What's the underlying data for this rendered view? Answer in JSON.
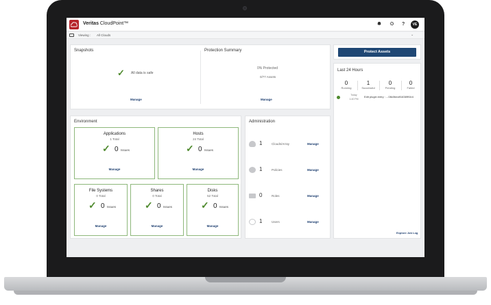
{
  "app": {
    "brand_bold": "Veritas",
    "brand_name": "CloudPoint",
    "brand_tm": "™",
    "user_initials": "VE"
  },
  "topbar_icons": {
    "alerts": "bell-icon",
    "settings": "gear-icon",
    "help": "?"
  },
  "subbar": {
    "viewing_label": "Viewing :",
    "viewing_value": "All Clouds"
  },
  "snapshots": {
    "title": "Snapshots",
    "message": "All data is safe",
    "manage": "Manage"
  },
  "protection": {
    "title": "Protection Summary",
    "percent": "0% Protected",
    "assets": "0/77 Assets",
    "manage": "Manage"
  },
  "environment": {
    "title": "Environment",
    "tiles": [
      {
        "title": "Applications",
        "total": "1 Total",
        "count": "0",
        "issues": "Issues",
        "manage": "Manage"
      },
      {
        "title": "Hosts",
        "total": "24 Total",
        "count": "0",
        "issues": "Issues",
        "manage": "Manage"
      },
      {
        "title": "File Systems",
        "total": "0 Total",
        "count": "0",
        "issues": "Issues",
        "manage": "Manage"
      },
      {
        "title": "Shares",
        "total": "0 Total",
        "count": "0",
        "issues": "Issues",
        "manage": "Manage"
      },
      {
        "title": "Disks",
        "total": "52 Total",
        "count": "0",
        "issues": "Issues",
        "manage": "Manage"
      }
    ]
  },
  "administration": {
    "title": "Administration",
    "rows": [
      {
        "icon": "cloud-icon",
        "count": "1",
        "label": "Clouds/Array",
        "manage": "Manage"
      },
      {
        "icon": "policy-icon",
        "count": "1",
        "label": "Policies",
        "manage": "Manage"
      },
      {
        "icon": "roles-icon",
        "count": "0",
        "label": "Roles",
        "manage": "Manage"
      },
      {
        "icon": "user-icon",
        "count": "1",
        "label": "Users",
        "manage": "Manage"
      }
    ]
  },
  "protect_assets": {
    "label": "Protect Assets"
  },
  "last24": {
    "title": "Last 24 Hours",
    "stats": [
      {
        "value": "0",
        "label": "Running"
      },
      {
        "value": "1",
        "label": "Successful"
      },
      {
        "value": "0",
        "label": "Pending"
      },
      {
        "value": "0",
        "label": "Failed"
      }
    ],
    "job": {
      "date": "Today",
      "time": "1:40 PM",
      "text": "Edit plugin entry : ...08c0bea916389f1b4"
    },
    "explore": "Explore Job Log"
  },
  "colors": {
    "accent": "#1f4774",
    "brand": "#b6252b",
    "success": "#4f8a2e",
    "tile_border": "#8db77a"
  }
}
